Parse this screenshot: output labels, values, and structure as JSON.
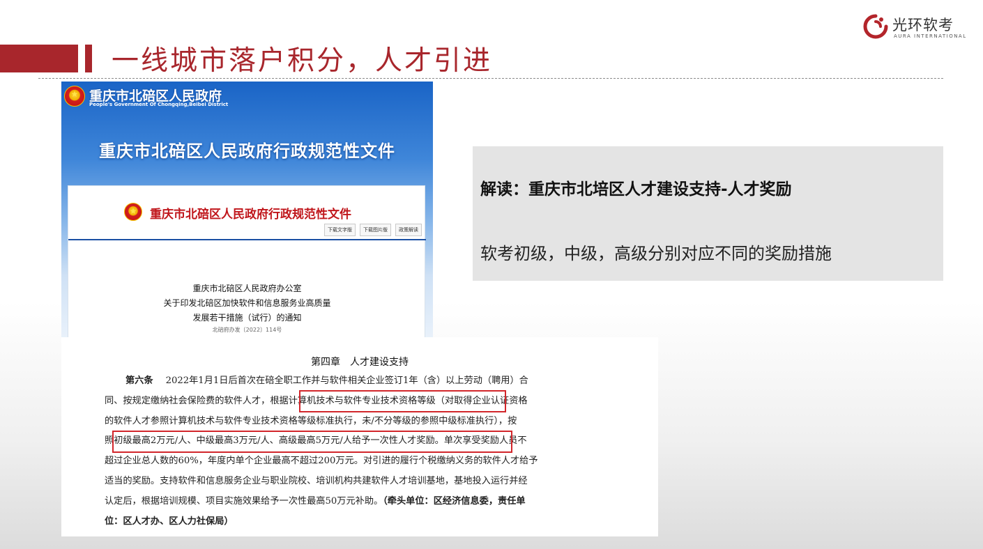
{
  "slide": {
    "title": "一线城市落户积分，人才引进",
    "logo": {
      "cn": "光环软考",
      "en": "AURA INTERNATIONAL",
      "icon": "aura-swirl-icon"
    },
    "accent_color": "#a8262c"
  },
  "doc_top": {
    "gov_name": "重庆市北碚区人民政府",
    "gov_name_en": "People's Government Of Chongqing,Beibei District",
    "banner_title": "重庆市北碚区人民政府行政规范性文件",
    "page_title": "重庆市北碚区人民政府行政规范性文件",
    "buttons": [
      "下载文字版",
      "下载图片版",
      "政策解读"
    ],
    "notice_lines": [
      "重庆市北碚区人民政府办公室",
      "关于印发北碚区加快软件和信息服务业高质量",
      "发展若干措施（试行）的通知"
    ],
    "doc_number": "北碚府办发〔2022〕114号"
  },
  "doc_bottom": {
    "chapter": "第四章　人才建设支持",
    "article_label": "第六条",
    "lines": [
      "2022年1月1日后首次在碚全职工作并与软件相关企业签订1年（含）以上劳动（聘用）合",
      "同、按规定缴纳社会保险费的软件人才，根据计算机技术与软件专业技术资格等级（对取得企业认证资格",
      "的软件人才参照计算机技术与软件专业技术资格等级标准执行，未/不分等级的参照中级标准执行），按",
      "照初级最高2万元/人、中级最高3万元/人、高级最高5万元/人给予一次性人才奖励。单次享受奖励人员不",
      "超过企业总人数的60%，年度内单个企业最高不超过200万元。对引进的履行个税缴纳义务的软件人才给予",
      "适当的奖励。支持软件和信息服务企业与职业院校、培训机构共建软件人才培训基地，基地投入运行并经",
      "认定后，根据培训规模、项目实施效果给予一次性最高50万元补助。"
    ],
    "responsible_tail": "（牵头单位：区经济信息委，责任单",
    "last_line": "位：区人才办、区人力社保局）",
    "highlight_color": "#d2262b"
  },
  "info_box": {
    "title": "解读：重庆市北培区人才建设支持-人才奖励",
    "body": "软考初级，中级，高级分别对应不同的奖励措施"
  }
}
